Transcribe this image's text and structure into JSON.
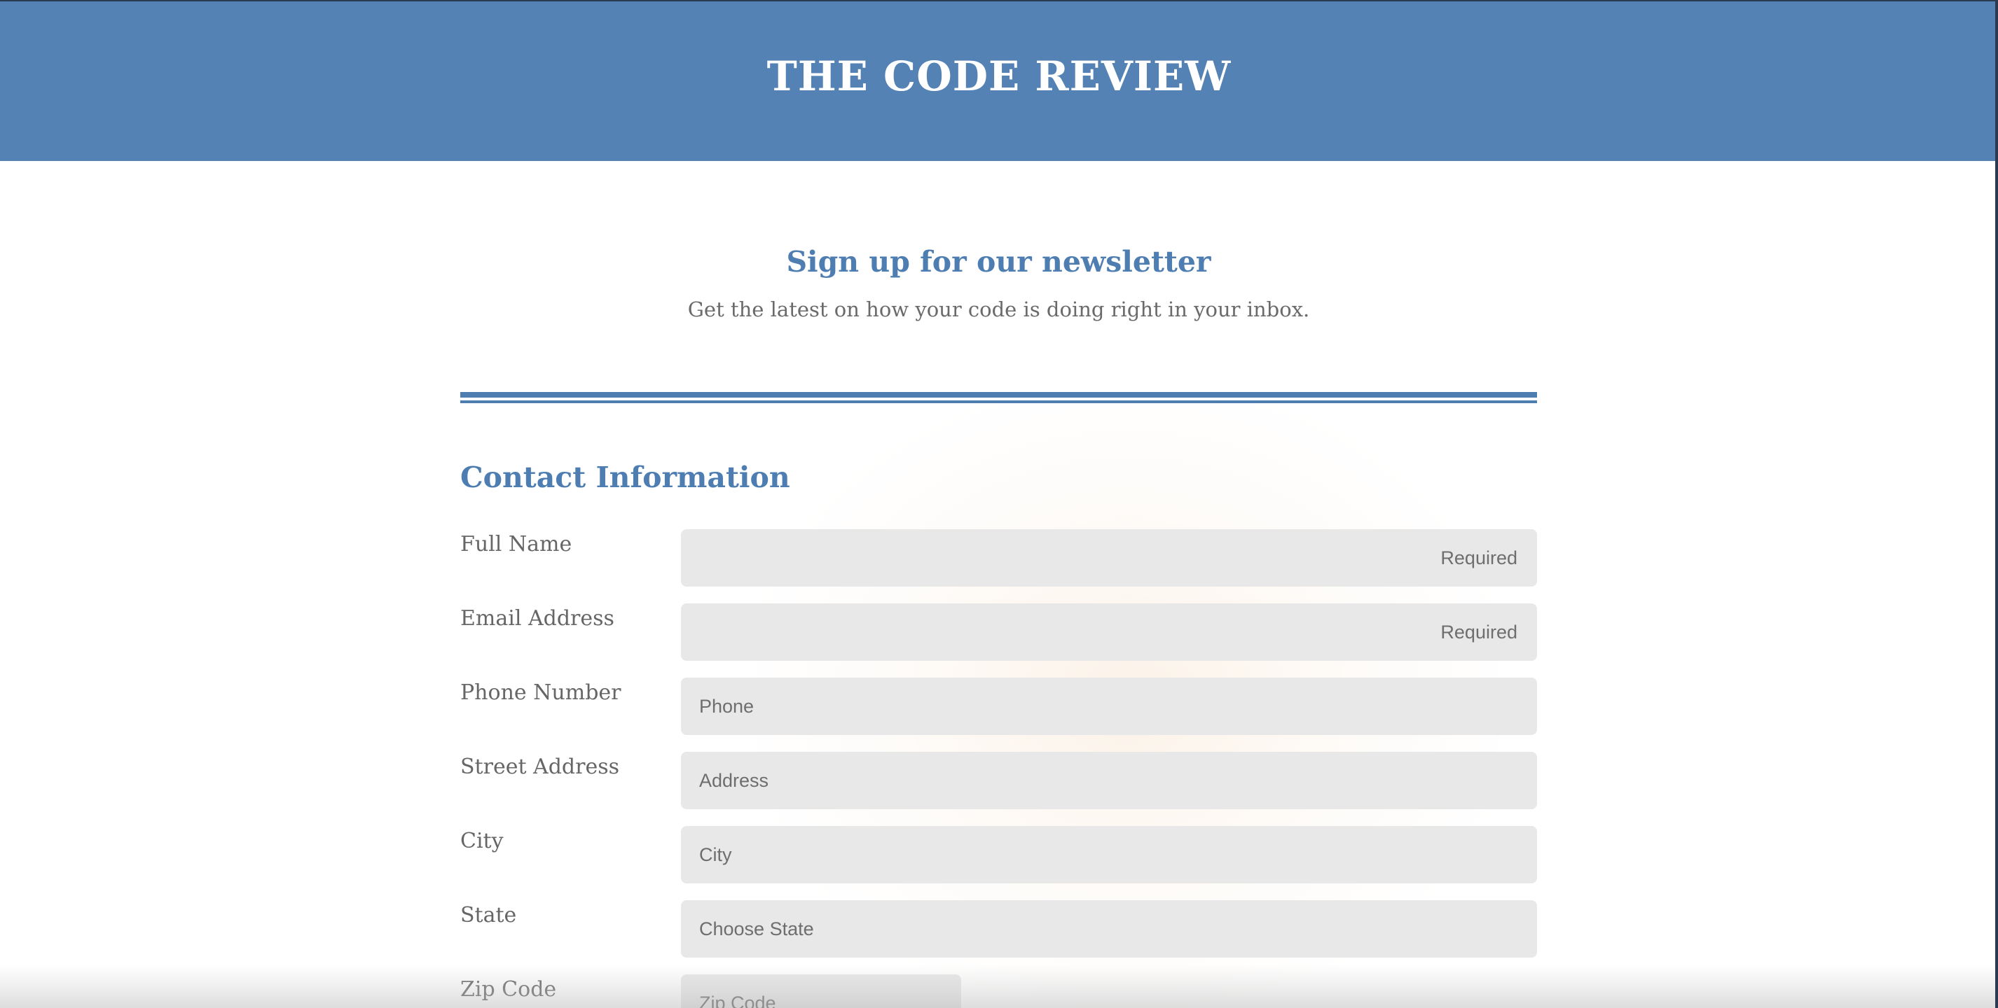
{
  "header": {
    "site_title": "THE CODE REVIEW"
  },
  "intro": {
    "heading": "Sign up for our newsletter",
    "subheading": "Get the latest on how your code is doing right in your inbox."
  },
  "contact": {
    "heading": "Contact Information",
    "fields": {
      "full_name": {
        "label": "Full Name",
        "placeholder": "Required",
        "value": ""
      },
      "email": {
        "label": "Email Address",
        "placeholder": "Required",
        "value": ""
      },
      "phone": {
        "label": "Phone Number",
        "placeholder": "Phone",
        "value": ""
      },
      "street": {
        "label": "Street Address",
        "placeholder": "Address",
        "value": ""
      },
      "city": {
        "label": "City",
        "placeholder": "City",
        "value": ""
      },
      "state": {
        "label": "State",
        "placeholder": "Choose State",
        "value": ""
      },
      "zip": {
        "label": "Zip Code",
        "placeholder": "Zip Code",
        "value": ""
      }
    }
  },
  "colors": {
    "brand_blue": "#5582b4",
    "heading_blue": "#4e7db2",
    "field_bg": "#e8e8e8",
    "label_gray": "#666666"
  }
}
